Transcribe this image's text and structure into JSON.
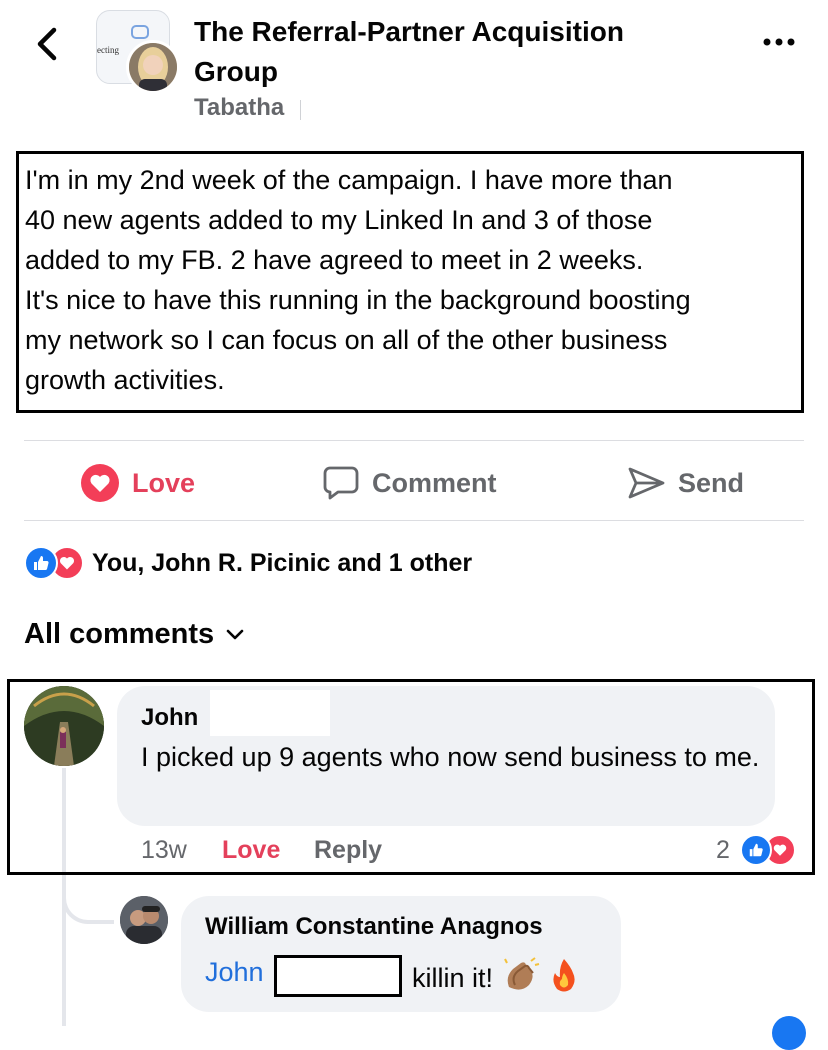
{
  "header": {
    "back_label": "Back",
    "group_name": "The Referral-Partner Acquisition Group",
    "group_avatar_text": "ecting",
    "author": "Tabatha"
  },
  "post": {
    "text": "I'm in my 2nd week of the campaign.  I have more than\n40 new agents added to my Linked In and 3 of those\nadded to my FB. 2 have agreed to meet in 2 weeks.\nIt's nice to have this running in the background boosting\nmy network so I can focus on all of the other business\ngrowth activities."
  },
  "actions": {
    "love": "Love",
    "comment": "Comment",
    "send": "Send"
  },
  "reactions": {
    "summary": "You, John R. Picinic and 1 other"
  },
  "comments_header": "All comments",
  "comments": [
    {
      "author": "John",
      "text": "I picked up 9 agents who now send business to me.",
      "time": "13w",
      "love": "Love",
      "reply": "Reply",
      "reaction_count": "2"
    }
  ],
  "replies": [
    {
      "author": "William Constantine Anagnos",
      "mention": "John",
      "text": "killin it!",
      "emojis": [
        "clapping-hands",
        "fire"
      ]
    }
  ],
  "colors": {
    "love_red": "#e4405b",
    "like_blue": "#1877f2",
    "muted_gray": "#65676b",
    "bubble_bg": "#f0f2f5",
    "mention_blue": "#216fdb"
  }
}
